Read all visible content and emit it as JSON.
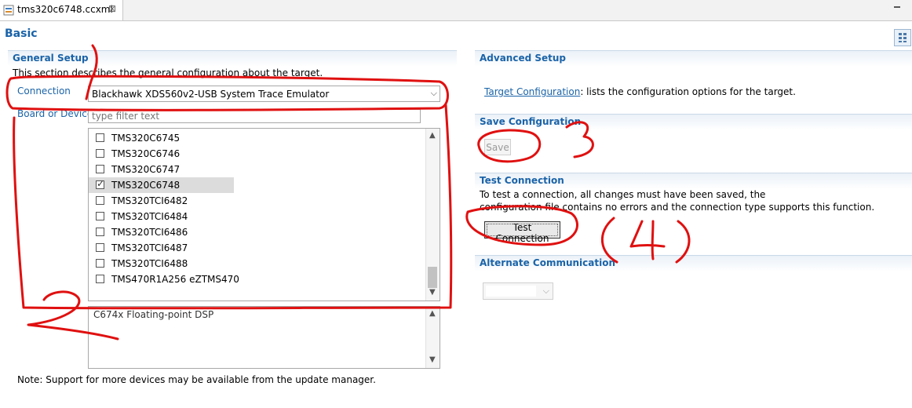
{
  "tab": {
    "title": "tms320c6748.ccxml",
    "close_glyph": "⊠"
  },
  "page": {
    "title": "Basic"
  },
  "general_setup": {
    "title": "General Setup",
    "description": "This section describes the general configuration about the target.",
    "connection_label": "Connection",
    "connection_value": "Blackhawk XDS560v2-USB System Trace Emulator",
    "board_label": "Board or Device",
    "filter_placeholder": "type filter text",
    "devices": [
      {
        "label": "TMS320C6745",
        "checked": false
      },
      {
        "label": "TMS320C6746",
        "checked": false
      },
      {
        "label": "TMS320C6747",
        "checked": false
      },
      {
        "label": "TMS320C6748",
        "checked": true
      },
      {
        "label": "TMS320TCI6482",
        "checked": false
      },
      {
        "label": "TMS320TCI6484",
        "checked": false
      },
      {
        "label": "TMS320TCI6486",
        "checked": false
      },
      {
        "label": "TMS320TCI6487",
        "checked": false
      },
      {
        "label": "TMS320TCI6488",
        "checked": false
      },
      {
        "label": "TMS470R1A256 eZTMS470",
        "checked": false
      }
    ],
    "device_description": "C674x Floating-point DSP",
    "note": "Note: Support for more devices may be available from the update manager."
  },
  "advanced_setup": {
    "title": "Advanced Setup",
    "link_text": "Target Configuration",
    "link_suffix": ": lists the configuration options for the target."
  },
  "save_configuration": {
    "title": "Save Configuration",
    "save_label": "Save"
  },
  "test_connection": {
    "title": "Test Connection",
    "line1": "To test a connection, all changes must have been saved, the",
    "line2": "configuration file contains no errors and the connection type supports this function.",
    "button_label": "Test Connection"
  },
  "alternate_communication": {
    "title": "Alternate Communication"
  },
  "annotations": {
    "color": "#e01010",
    "labels": [
      "2",
      "3",
      "(4)"
    ]
  },
  "colors": {
    "accent": "#1a63a8",
    "annotation": "#e01010"
  }
}
